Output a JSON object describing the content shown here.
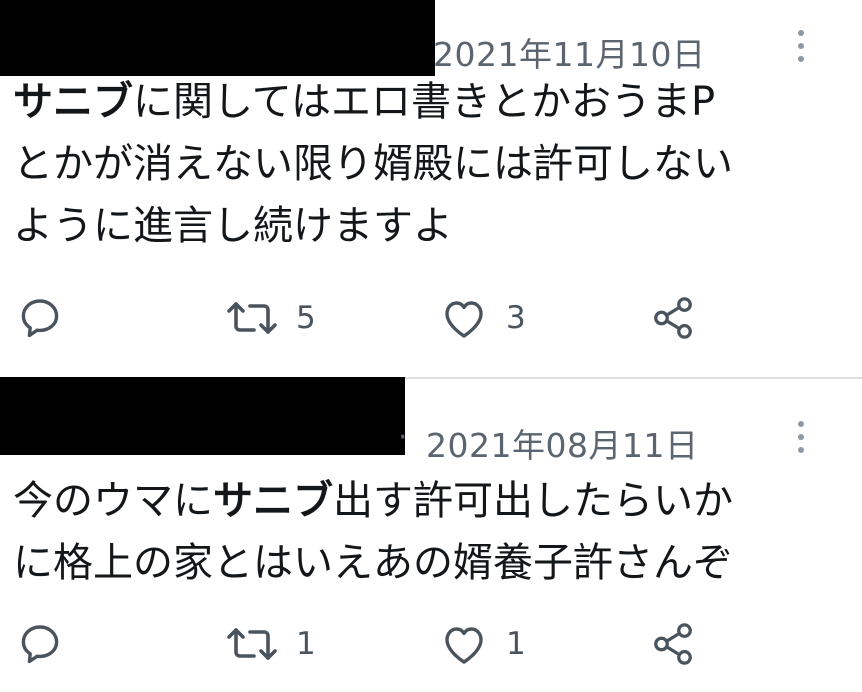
{
  "tweets": [
    {
      "date": "2021年11月10日",
      "body": {
        "bold": "サニブ",
        "line1_rest": "に関してはエロ書きとかおうまP",
        "line2": "とかが消えない限り婿殿には許可しない",
        "line3": "ように進言し続けますよ"
      },
      "actions": {
        "reply_count": "",
        "retweet_count": "5",
        "like_count": "3"
      }
    },
    {
      "separator": "·",
      "date": "2021年08月11日",
      "body": {
        "line1_pre": "今のウマに",
        "bold": "サニブ",
        "line1_post": "出す許可出したらいか",
        "line2": "に格上の家とはいえあの婿養子許さんぞ"
      },
      "actions": {
        "reply_count": "",
        "retweet_count": "1",
        "like_count": "1"
      }
    }
  ],
  "icons": {
    "more": "more-vertical-icon",
    "reply": "reply-icon",
    "retweet": "retweet-icon",
    "like": "heart-icon",
    "share": "share-icon"
  },
  "colors": {
    "text": "#14171a",
    "muted": "#5b6570",
    "icon": "#4a545e",
    "divider": "#dadee2"
  }
}
